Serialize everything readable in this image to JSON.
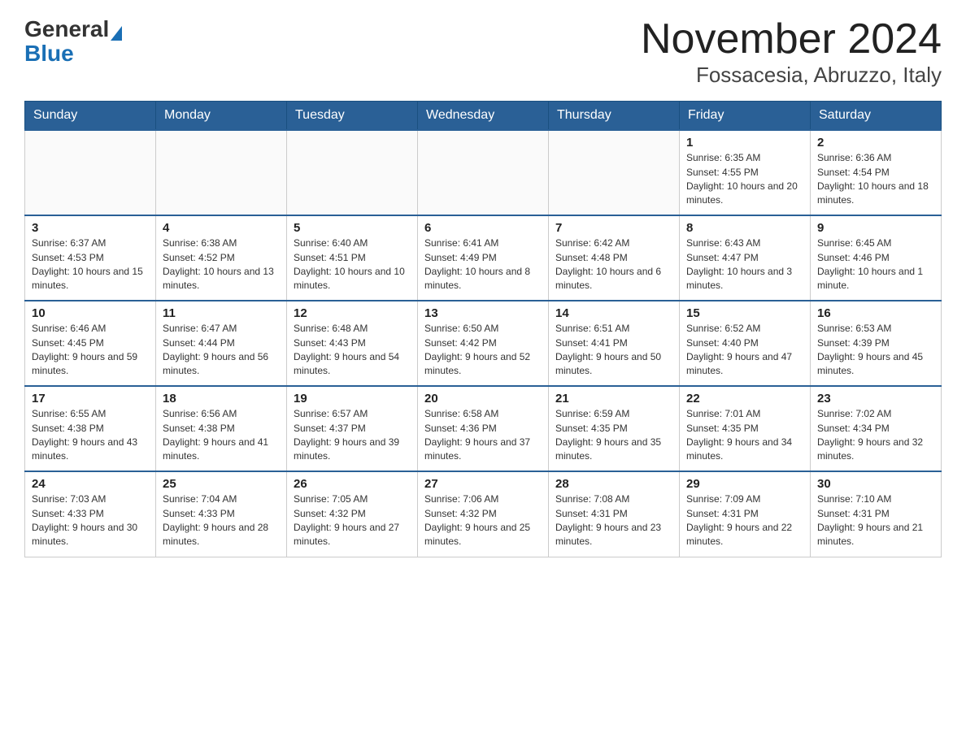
{
  "logo": {
    "general": "General",
    "blue": "Blue"
  },
  "title": "November 2024",
  "subtitle": "Fossacesia, Abruzzo, Italy",
  "days": [
    "Sunday",
    "Monday",
    "Tuesday",
    "Wednesday",
    "Thursday",
    "Friday",
    "Saturday"
  ],
  "weeks": [
    [
      {
        "day": "",
        "sunrise": "",
        "sunset": "",
        "daylight": ""
      },
      {
        "day": "",
        "sunrise": "",
        "sunset": "",
        "daylight": ""
      },
      {
        "day": "",
        "sunrise": "",
        "sunset": "",
        "daylight": ""
      },
      {
        "day": "",
        "sunrise": "",
        "sunset": "",
        "daylight": ""
      },
      {
        "day": "",
        "sunrise": "",
        "sunset": "",
        "daylight": ""
      },
      {
        "day": "1",
        "sunrise": "Sunrise: 6:35 AM",
        "sunset": "Sunset: 4:55 PM",
        "daylight": "Daylight: 10 hours and 20 minutes."
      },
      {
        "day": "2",
        "sunrise": "Sunrise: 6:36 AM",
        "sunset": "Sunset: 4:54 PM",
        "daylight": "Daylight: 10 hours and 18 minutes."
      }
    ],
    [
      {
        "day": "3",
        "sunrise": "Sunrise: 6:37 AM",
        "sunset": "Sunset: 4:53 PM",
        "daylight": "Daylight: 10 hours and 15 minutes."
      },
      {
        "day": "4",
        "sunrise": "Sunrise: 6:38 AM",
        "sunset": "Sunset: 4:52 PM",
        "daylight": "Daylight: 10 hours and 13 minutes."
      },
      {
        "day": "5",
        "sunrise": "Sunrise: 6:40 AM",
        "sunset": "Sunset: 4:51 PM",
        "daylight": "Daylight: 10 hours and 10 minutes."
      },
      {
        "day": "6",
        "sunrise": "Sunrise: 6:41 AM",
        "sunset": "Sunset: 4:49 PM",
        "daylight": "Daylight: 10 hours and 8 minutes."
      },
      {
        "day": "7",
        "sunrise": "Sunrise: 6:42 AM",
        "sunset": "Sunset: 4:48 PM",
        "daylight": "Daylight: 10 hours and 6 minutes."
      },
      {
        "day": "8",
        "sunrise": "Sunrise: 6:43 AM",
        "sunset": "Sunset: 4:47 PM",
        "daylight": "Daylight: 10 hours and 3 minutes."
      },
      {
        "day": "9",
        "sunrise": "Sunrise: 6:45 AM",
        "sunset": "Sunset: 4:46 PM",
        "daylight": "Daylight: 10 hours and 1 minute."
      }
    ],
    [
      {
        "day": "10",
        "sunrise": "Sunrise: 6:46 AM",
        "sunset": "Sunset: 4:45 PM",
        "daylight": "Daylight: 9 hours and 59 minutes."
      },
      {
        "day": "11",
        "sunrise": "Sunrise: 6:47 AM",
        "sunset": "Sunset: 4:44 PM",
        "daylight": "Daylight: 9 hours and 56 minutes."
      },
      {
        "day": "12",
        "sunrise": "Sunrise: 6:48 AM",
        "sunset": "Sunset: 4:43 PM",
        "daylight": "Daylight: 9 hours and 54 minutes."
      },
      {
        "day": "13",
        "sunrise": "Sunrise: 6:50 AM",
        "sunset": "Sunset: 4:42 PM",
        "daylight": "Daylight: 9 hours and 52 minutes."
      },
      {
        "day": "14",
        "sunrise": "Sunrise: 6:51 AM",
        "sunset": "Sunset: 4:41 PM",
        "daylight": "Daylight: 9 hours and 50 minutes."
      },
      {
        "day": "15",
        "sunrise": "Sunrise: 6:52 AM",
        "sunset": "Sunset: 4:40 PM",
        "daylight": "Daylight: 9 hours and 47 minutes."
      },
      {
        "day": "16",
        "sunrise": "Sunrise: 6:53 AM",
        "sunset": "Sunset: 4:39 PM",
        "daylight": "Daylight: 9 hours and 45 minutes."
      }
    ],
    [
      {
        "day": "17",
        "sunrise": "Sunrise: 6:55 AM",
        "sunset": "Sunset: 4:38 PM",
        "daylight": "Daylight: 9 hours and 43 minutes."
      },
      {
        "day": "18",
        "sunrise": "Sunrise: 6:56 AM",
        "sunset": "Sunset: 4:38 PM",
        "daylight": "Daylight: 9 hours and 41 minutes."
      },
      {
        "day": "19",
        "sunrise": "Sunrise: 6:57 AM",
        "sunset": "Sunset: 4:37 PM",
        "daylight": "Daylight: 9 hours and 39 minutes."
      },
      {
        "day": "20",
        "sunrise": "Sunrise: 6:58 AM",
        "sunset": "Sunset: 4:36 PM",
        "daylight": "Daylight: 9 hours and 37 minutes."
      },
      {
        "day": "21",
        "sunrise": "Sunrise: 6:59 AM",
        "sunset": "Sunset: 4:35 PM",
        "daylight": "Daylight: 9 hours and 35 minutes."
      },
      {
        "day": "22",
        "sunrise": "Sunrise: 7:01 AM",
        "sunset": "Sunset: 4:35 PM",
        "daylight": "Daylight: 9 hours and 34 minutes."
      },
      {
        "day": "23",
        "sunrise": "Sunrise: 7:02 AM",
        "sunset": "Sunset: 4:34 PM",
        "daylight": "Daylight: 9 hours and 32 minutes."
      }
    ],
    [
      {
        "day": "24",
        "sunrise": "Sunrise: 7:03 AM",
        "sunset": "Sunset: 4:33 PM",
        "daylight": "Daylight: 9 hours and 30 minutes."
      },
      {
        "day": "25",
        "sunrise": "Sunrise: 7:04 AM",
        "sunset": "Sunset: 4:33 PM",
        "daylight": "Daylight: 9 hours and 28 minutes."
      },
      {
        "day": "26",
        "sunrise": "Sunrise: 7:05 AM",
        "sunset": "Sunset: 4:32 PM",
        "daylight": "Daylight: 9 hours and 27 minutes."
      },
      {
        "day": "27",
        "sunrise": "Sunrise: 7:06 AM",
        "sunset": "Sunset: 4:32 PM",
        "daylight": "Daylight: 9 hours and 25 minutes."
      },
      {
        "day": "28",
        "sunrise": "Sunrise: 7:08 AM",
        "sunset": "Sunset: 4:31 PM",
        "daylight": "Daylight: 9 hours and 23 minutes."
      },
      {
        "day": "29",
        "sunrise": "Sunrise: 7:09 AM",
        "sunset": "Sunset: 4:31 PM",
        "daylight": "Daylight: 9 hours and 22 minutes."
      },
      {
        "day": "30",
        "sunrise": "Sunrise: 7:10 AM",
        "sunset": "Sunset: 4:31 PM",
        "daylight": "Daylight: 9 hours and 21 minutes."
      }
    ]
  ]
}
